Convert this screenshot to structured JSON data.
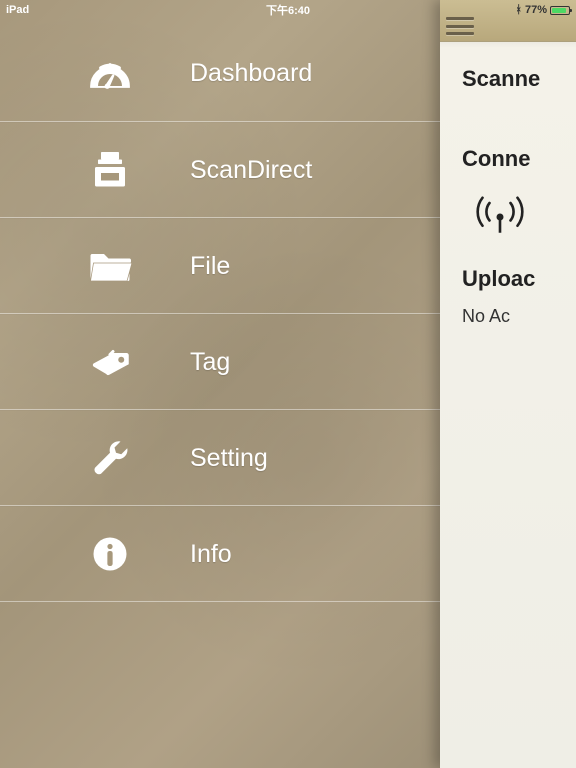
{
  "statusbar": {
    "device": "iPad",
    "time": "下午6:40",
    "battery_pct": "77%"
  },
  "sidebar": {
    "items": [
      {
        "label": "Dashboard"
      },
      {
        "label": "ScanDirect"
      },
      {
        "label": "File"
      },
      {
        "label": "Tag"
      },
      {
        "label": "Setting"
      },
      {
        "label": "Info"
      }
    ]
  },
  "pane": {
    "section1_title": "Scanne",
    "section2_title": "Conne",
    "section3_title": "Uploac",
    "no_account": "No Ac"
  }
}
